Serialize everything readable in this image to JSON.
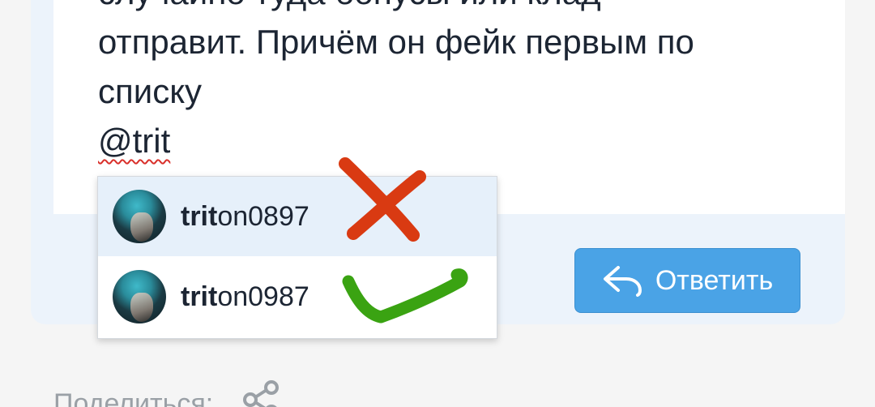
{
  "editor": {
    "lines": [
      "случайно туда бонусы или клад",
      "отправит. Причём он фейк первым по",
      "списку"
    ],
    "mention_text": "@trit"
  },
  "mention_dropdown": {
    "items": [
      {
        "match": "trit",
        "rest": "on0897",
        "highlighted": true
      },
      {
        "match": "trit",
        "rest": "on0987",
        "highlighted": false
      }
    ]
  },
  "reply_button": {
    "label": "Ответить",
    "icon": "reply-arrow-icon"
  },
  "share": {
    "label": "Поделиться:",
    "icon": "share-icon"
  },
  "annotations": {
    "wrong_mark": {
      "icon": "red-cross-mark",
      "color": "#d93a12"
    },
    "right_mark": {
      "icon": "green-check-mark",
      "color": "#3aa312"
    }
  },
  "colors": {
    "accent": "#4aa3e6",
    "highlight_row": "#e6f0fa",
    "editor_footer": "#ecf3fb"
  }
}
